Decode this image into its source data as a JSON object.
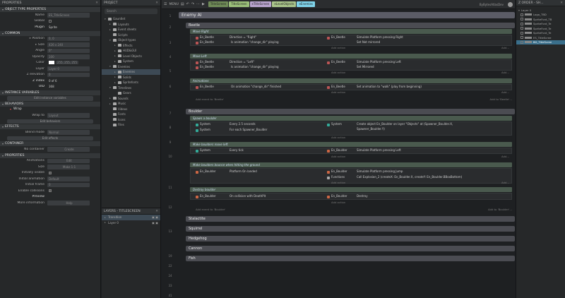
{
  "props": {
    "title": "PROPERTIES",
    "close": "✕",
    "object_type_section": "OBJECT TYPE PROPERTIES",
    "name_label": "Name",
    "name_value": "ES_TitleScreen",
    "global_label": "Global",
    "plugin_label": "Plugin",
    "plugin_value": "Sprite",
    "common_section": "COMMON",
    "position_label": "Position",
    "position_value": "0, 0",
    "size_label": "Size",
    "size_value": "426 x 240",
    "angle_label": "Angle",
    "angle_value": "0°",
    "opacity_label": "Opacity",
    "opacity_value": "100",
    "color_label": "Color",
    "color_value": "255, 255, 255",
    "layer_label": "Layer",
    "layer_value": "Layer 0",
    "zelev_label": "Z elevation",
    "zelev_value": "0",
    "zindex_label": "Z index",
    "zindex_value": "0 of 6",
    "uid_label": "UID",
    "uid_value": "368",
    "instvars_section": "INSTANCE VARIABLES",
    "instvars_btn": "Edit instance variables",
    "behaviors_section": "BEHAVIORS",
    "wrap_label": "Wrap",
    "wrapto_label": "Wrap to",
    "wrapto_value": "Layout",
    "behaviors_btn": "Edit behaviors",
    "effects_section": "EFFECTS",
    "blend_label": "Blend mode",
    "blend_value": "Normal",
    "effects_btn": "Edit effects",
    "container_section": "CONTAINER",
    "nocontainer_label": "No container",
    "create_btn": "Create",
    "properties_section": "PROPERTIES",
    "anims_label": "Animations",
    "anims_btn": "Edit",
    "sizep_label": "Size",
    "sizep_btn": "Make 1:1",
    "initvis_label": "Initially visible",
    "initanim_label": "Initial animation",
    "initanim_value": "Default",
    "initframe_label": "Initial frame",
    "initframe_value": "0",
    "collisions_label": "Enable collisions",
    "preview_label": "Preview",
    "moreinfo_label": "More information",
    "help_btn": "Help"
  },
  "project": {
    "title": "PROJECT",
    "close": "✕",
    "search": "Search",
    "items": [
      {
        "label": "Gauntlet",
        "depth": 0,
        "arrow": "▾"
      },
      {
        "label": "Layouts",
        "depth": 1,
        "arrow": "▸"
      },
      {
        "label": "Event sheets",
        "depth": 1,
        "arrow": "▸"
      },
      {
        "label": "Scripts",
        "depth": 1,
        "arrow": ""
      },
      {
        "label": "Object types",
        "depth": 1,
        "arrow": "▾"
      },
      {
        "label": "Effects",
        "depth": 2,
        "arrow": "▸"
      },
      {
        "label": "HUD&GUI",
        "depth": 2,
        "arrow": "▸"
      },
      {
        "label": "Level Objects",
        "depth": 2,
        "arrow": "▸"
      },
      {
        "label": "System",
        "depth": 2,
        "arrow": "▸"
      },
      {
        "label": "Enemies",
        "depth": 1,
        "arrow": "▾"
      },
      {
        "label": "Enemies",
        "depth": 2,
        "arrow": "▸"
      },
      {
        "label": "Solids",
        "depth": 2,
        "arrow": "▸"
      },
      {
        "label": "Spritefonts",
        "depth": 2,
        "arrow": "▸"
      },
      {
        "label": "Timelines",
        "depth": 1,
        "arrow": "▾"
      },
      {
        "label": "Gears",
        "depth": 2,
        "arrow": ""
      },
      {
        "label": "Sounds",
        "depth": 1,
        "arrow": "▸"
      },
      {
        "label": "Music",
        "depth": 1,
        "arrow": "▸"
      },
      {
        "label": "Videos",
        "depth": 1,
        "arrow": ""
      },
      {
        "label": "Fonts",
        "depth": 1,
        "arrow": ""
      },
      {
        "label": "Icons",
        "depth": 1,
        "arrow": ""
      },
      {
        "label": "Files",
        "depth": 1,
        "arrow": ""
      }
    ],
    "layers_title": "LAYERS - TITLESCREEN",
    "layers": [
      "Transition",
      "Layer 0"
    ]
  },
  "toolbar": {
    "menu": "MENU",
    "tabs": [
      {
        "label": "TitleScreen",
        "color": "#6f8b57"
      },
      {
        "label": "TitleScreen",
        "color": "#9bbf7a"
      },
      {
        "label": "eTitleScreen",
        "color": "#b9a4cf"
      },
      {
        "label": "eLevelObjects",
        "color": "#a9c48a"
      },
      {
        "label": "eEnemies",
        "color": "#7fd3ea"
      }
    ],
    "user": "ByBytesAtlasDev"
  },
  "events": {
    "enemy_ai": "Enemy AI",
    "beetle": "Beetle",
    "move_right": "Move Right",
    "move_left": "Move Left",
    "animations": "Animations",
    "en_beetle": "En_Beetle",
    "direction_right": "Direction = \"Right\"",
    "direction_left": "Direction = \"Left\"",
    "anim_change_dir": "Is animation \"change_dir\" playing",
    "on_anim_finished": "On animation \"change_dir\" finished",
    "simulate_right": "Simulate  Platform pressing Right",
    "set_not_mirrored": "Set Not mirrored",
    "simulate_left": "Simulate  Platform pressing Left",
    "set_mirrored": "Set Mirrored",
    "set_anim_walk": "Set animation to \"walk\" (play from beginning)",
    "add_action": "Add action",
    "add": "Add...",
    "add_event_beetle": "Add event to 'Beetle'",
    "add_to_beetle": "Add to 'Beetle'...",
    "boulder": "Boulder",
    "spawn_boulder": "Spawn a boulder",
    "system": "System",
    "every_25": "Every 2.5 seconds",
    "for_each": "For each  Spawner_Boulder",
    "create_object": "Create object  En_Boulder on layer \"Objects\" at (Spawner_Boulder.X,",
    "create_object2": "Spawner_Boulder.Y)",
    "make_move_left": "Make boulders move left",
    "every_tick": "Every tick",
    "en_boulder": "En_Boulder",
    "bounce_comment": "Make boulders bounce when hitting the ground",
    "platform_landed": "Platform On landed",
    "simulate_jump": "Simulate  Platform pressing Jump",
    "functions": "Functions",
    "call_explosion": "Call Explosion_2 (createX: En_Boulder.X, createY: En_Boulder.BBoxBottom)",
    "destroy_comment": "Destroy boulder",
    "on_collision": "On collision with  DeathPit",
    "destroy": "Destroy",
    "add_event_boulder": "Add event to 'Boulder'",
    "add_to_boulder": "Add to 'Boulder'...",
    "stalactite": "Stalactite",
    "squirrel": "Squirrel",
    "hedgehog": "Hedgehog",
    "cannon": "Cannon",
    "fish": "Fish",
    "lines": [
      "1",
      "2",
      "3",
      "4",
      "5",
      "6",
      "7",
      "8",
      "9",
      "10",
      "11",
      "12",
      "13",
      "19",
      "22",
      "24",
      "33",
      "41"
    ]
  },
  "zorder": {
    "title": "Z ORDER - SH...",
    "items": [
      "Layer 0",
      "Logo_TBD",
      "SpriteFont_TB",
      "SpriteFont_Te",
      "SpriteFont_Te",
      "SpriteFont_Te",
      "ES_TitleScree",
      "BG_TitleScree"
    ]
  }
}
